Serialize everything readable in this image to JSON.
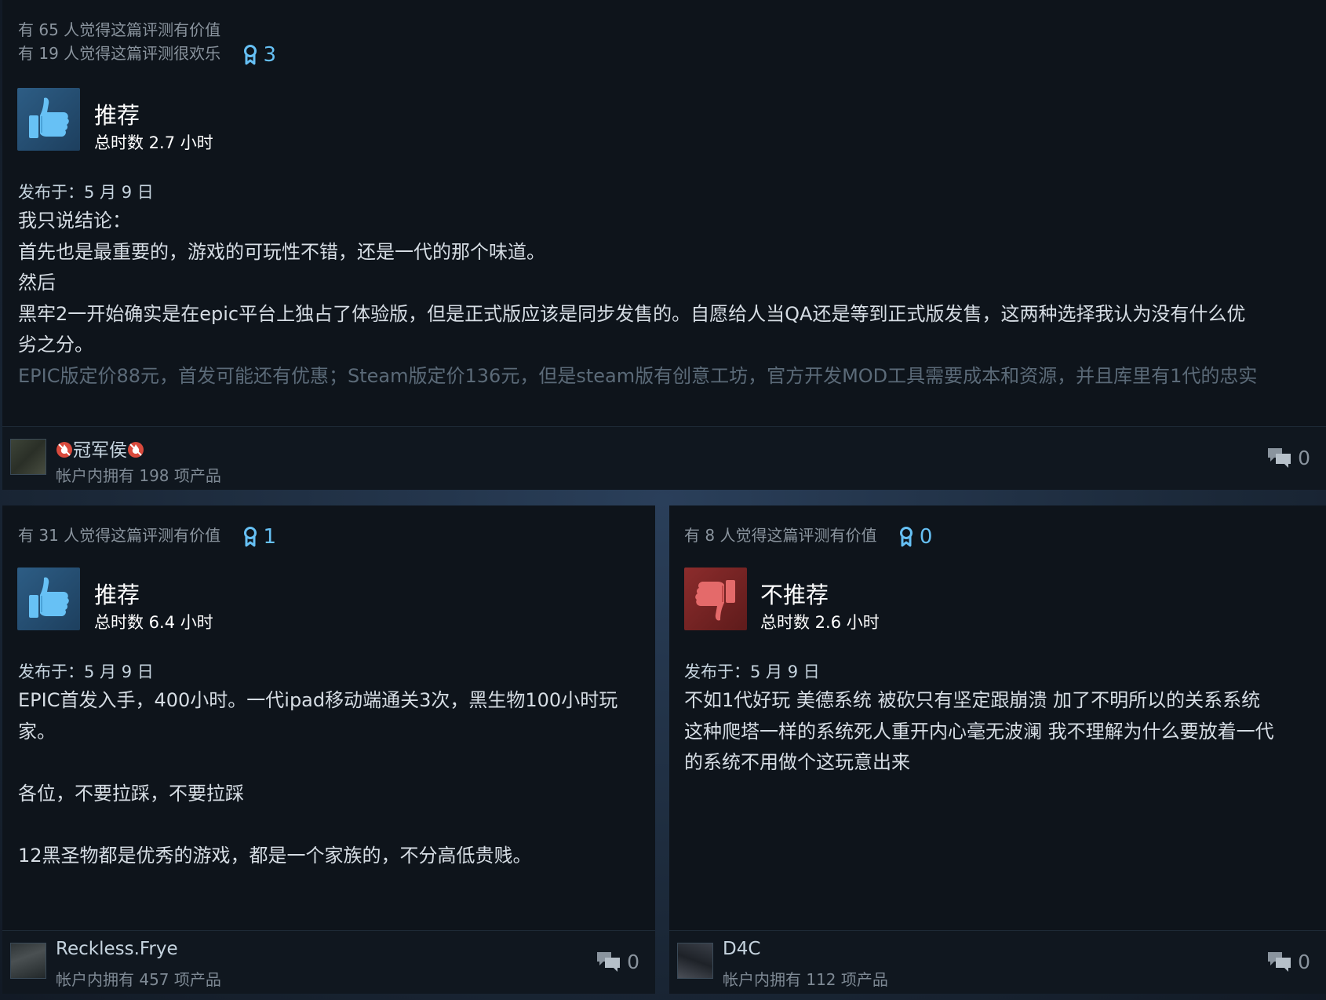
{
  "reviews": [
    {
      "helpful_text": "有 65 人觉得这篇评测有价值",
      "funny_text": "有 19 人觉得这篇评测很欢乐",
      "award_count": "3",
      "verdict": "推荐",
      "verdict_type": "recommended",
      "hours": "总时数 2.7 小时",
      "posted": "发布于：5 月 9 日",
      "body_lines": [
        "我只说结论：",
        "首先也是最重要的，游戏的可玩性不错，还是一代的那个味道。",
        "然后",
        "黑牢2一开始确实是在epic平台上独占了体验版，但是正式版应该是同步发售的。自愿给人当QA还是等到正式版发售，这两种选择我认为没有什么优",
        "劣之分。"
      ],
      "faded_line": "EPIC版定价88元，首发可能还有优惠；Steam版定价136元，但是steam版有创意工坊，官方开发MOD工具需要成本和资源，并且库里有1代的忠实",
      "author": "冠军侯",
      "author_decor_icon": "fire-emoji-icon",
      "owned": "帐户内拥有 198 项产品",
      "comment_count": "0"
    },
    {
      "helpful_text": "有 31 人觉得这篇评测有价值",
      "award_count": "1",
      "verdict": "推荐",
      "verdict_type": "recommended",
      "hours": "总时数 6.4 小时",
      "posted": "发布于：5 月 9 日",
      "body_lines": [
        "EPIC首发入手，400小时。一代ipad移动端通关3次，黑生物100小时玩",
        "家。",
        "",
        "各位，不要拉踩，不要拉踩",
        "",
        "12黑圣物都是优秀的游戏，都是一个家族的，不分高低贵贱。"
      ],
      "author": "Reckless.Frye",
      "owned": "帐户内拥有 457 项产品",
      "comment_count": "0"
    },
    {
      "helpful_text": "有 8 人觉得这篇评测有价值",
      "award_count": "0",
      "verdict": "不推荐",
      "verdict_type": "not-recommended",
      "hours": "总时数 2.6 小时",
      "posted": "发布于：5 月 9 日",
      "body_lines": [
        "不如1代好玩 美德系统 被砍只有坚定跟崩溃 加了不明所以的关系系统",
        "这种爬塔一样的系统死人重开内心毫无波澜 我不理解为什么要放着一代",
        "的系统不用做个这玩意出来"
      ],
      "author": "D4C",
      "owned": "帐户内拥有 112 项产品",
      "comment_count": "0"
    }
  ],
  "colors": {
    "card_bg": "#0e141b",
    "award_blue": "#66c0f4",
    "thumb_up_bg": "#2d5d85",
    "thumb_down_bg": "#8c2c2c",
    "page_bg": "#1b2838"
  }
}
